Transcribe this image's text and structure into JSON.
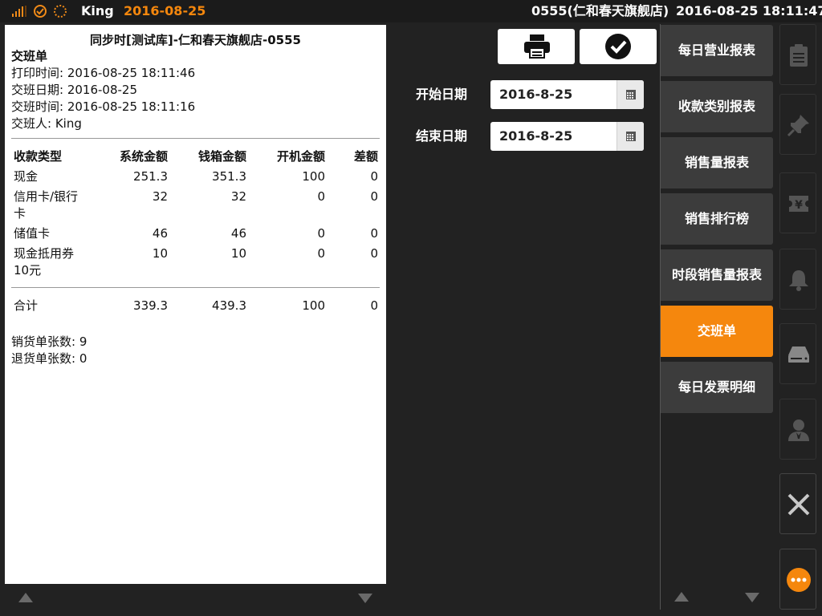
{
  "statusbar": {
    "user": "King",
    "date": "2016-08-25",
    "store": "0555(仁和春天旗舰店)",
    "datetime": "2016-08-25 18:11:47"
  },
  "receipt": {
    "title": "同步时[测试库]-仁和春天旗舰店-0555",
    "doc_type": "交班单",
    "print_time": "打印时间: 2016-08-25 18:11:46",
    "shift_date": "交班日期: 2016-08-25",
    "shift_time": "交班时间: 2016-08-25 18:11:16",
    "shift_person": "交班人: King",
    "columns": [
      "收款类型",
      "系统金额",
      "钱箱金额",
      "开机金额",
      "差额"
    ],
    "rows": [
      {
        "type": "现金",
        "type2": "",
        "system": "251.3",
        "cashbox": "351.3",
        "opening": "100",
        "diff": "0"
      },
      {
        "type": "信用卡/银行",
        "type2": "卡",
        "system": "32",
        "cashbox": "32",
        "opening": "0",
        "diff": "0"
      },
      {
        "type": "储值卡",
        "type2": "",
        "system": "46",
        "cashbox": "46",
        "opening": "0",
        "diff": "0"
      },
      {
        "type": "现金抵用券",
        "type2": "10元",
        "system": "10",
        "cashbox": "10",
        "opening": "0",
        "diff": "0"
      }
    ],
    "total": {
      "type": "合计",
      "system": "339.3",
      "cashbox": "439.3",
      "opening": "100",
      "diff": "0"
    },
    "sales_count": "销货单张数: 9",
    "return_count": "退货单张数: 0"
  },
  "filters": {
    "start_label": "开始日期",
    "start_value": "2016-8-25",
    "end_label": "结束日期",
    "end_value": "2016-8-25"
  },
  "menu": [
    {
      "label": "每日营业报表",
      "active": false
    },
    {
      "label": "收款类别报表",
      "active": false
    },
    {
      "label": "销售量报表",
      "active": false
    },
    {
      "label": "销售排行榜",
      "active": false
    },
    {
      "label": "时段销售量报表",
      "active": false
    },
    {
      "label": "交班单",
      "active": true
    },
    {
      "label": "每日发票明细",
      "active": false
    }
  ],
  "rail_icons": [
    "clipboard-icon",
    "pin-icon",
    "ticket-yen-icon",
    "bell-icon",
    "drive-icon",
    "cashier-icon",
    "close-icon",
    "more-icon"
  ],
  "colors": {
    "accent": "#f5870d",
    "background": "#222222",
    "menu_bg": "#3c3c3c"
  }
}
